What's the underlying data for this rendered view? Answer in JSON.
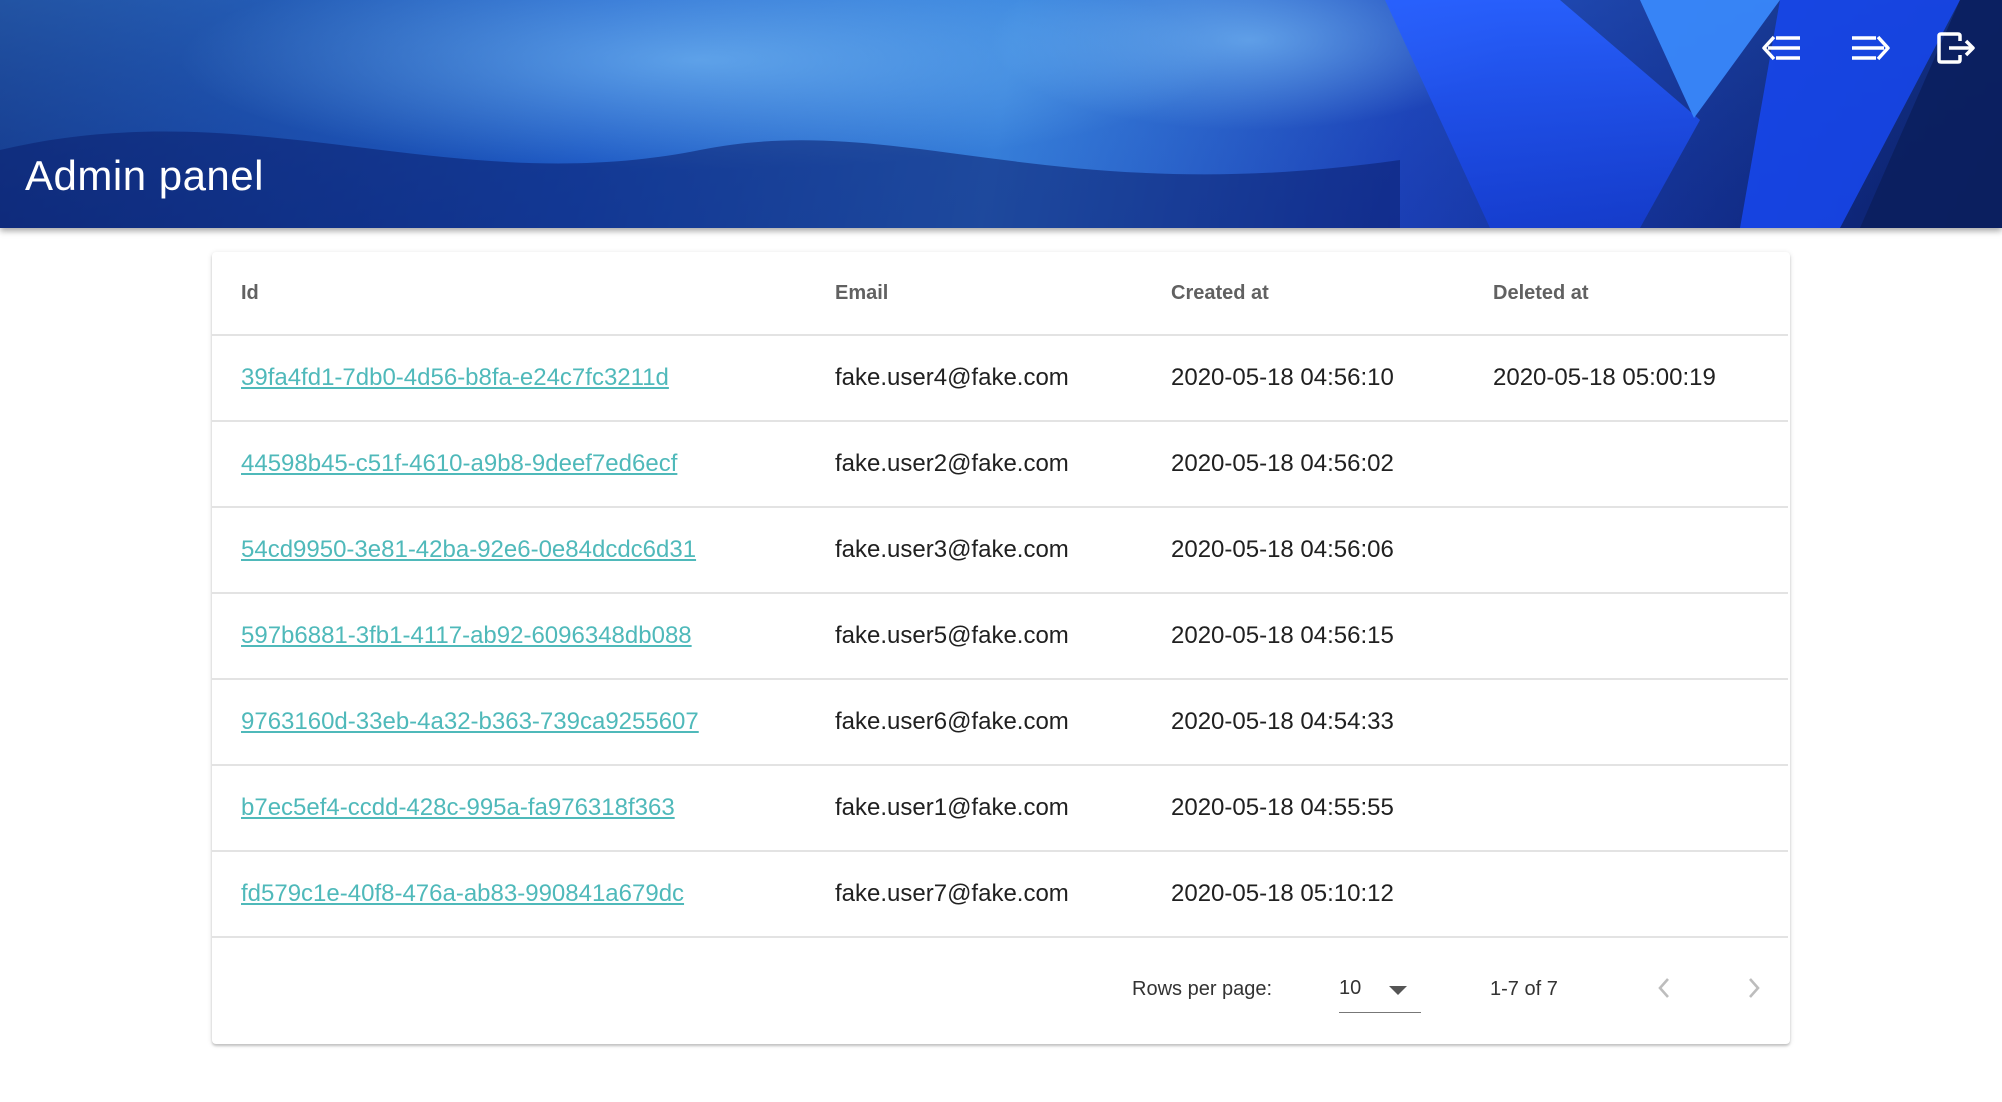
{
  "header": {
    "title": "Admin panel",
    "icons": [
      "collapse-left-icon",
      "expand-right-icon",
      "logout-icon"
    ]
  },
  "table": {
    "columns": [
      "Id",
      "Email",
      "Created at",
      "Deleted at"
    ],
    "rows": [
      {
        "id": "39fa4fd1-7db0-4d56-b8fa-e24c7fc3211d",
        "email": "fake.user4@fake.com",
        "created_at": "2020-05-18 04:56:10",
        "deleted_at": "2020-05-18 05:00:19"
      },
      {
        "id": "44598b45-c51f-4610-a9b8-9deef7ed6ecf",
        "email": "fake.user2@fake.com",
        "created_at": "2020-05-18 04:56:02",
        "deleted_at": ""
      },
      {
        "id": "54cd9950-3e81-42ba-92e6-0e84dcdc6d31",
        "email": "fake.user3@fake.com",
        "created_at": "2020-05-18 04:56:06",
        "deleted_at": ""
      },
      {
        "id": "597b6881-3fb1-4117-ab92-6096348db088",
        "email": "fake.user5@fake.com",
        "created_at": "2020-05-18 04:56:15",
        "deleted_at": ""
      },
      {
        "id": "9763160d-33eb-4a32-b363-739ca9255607",
        "email": "fake.user6@fake.com",
        "created_at": "2020-05-18 04:54:33",
        "deleted_at": ""
      },
      {
        "id": "b7ec5ef4-ccdd-428c-995a-fa976318f363",
        "email": "fake.user1@fake.com",
        "created_at": "2020-05-18 04:55:55",
        "deleted_at": ""
      },
      {
        "id": "fd579c1e-40f8-476a-ab83-990841a679dc",
        "email": "fake.user7@fake.com",
        "created_at": "2020-05-18 05:10:12",
        "deleted_at": ""
      }
    ]
  },
  "pagination": {
    "rows_per_page_label": "Rows per page:",
    "rows_per_page_value": "10",
    "range_text": "1-7 of 7"
  },
  "colors": {
    "link": "#4fb9ba",
    "header_accent": "#1a55c4"
  }
}
